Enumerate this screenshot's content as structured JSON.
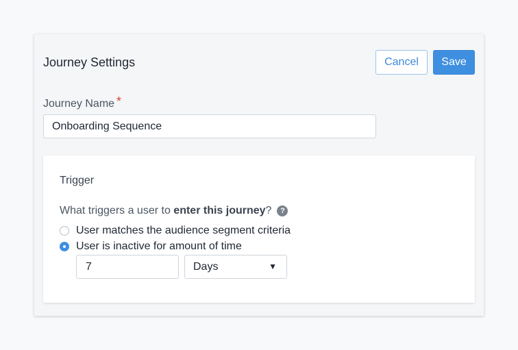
{
  "header": {
    "title": "Journey Settings",
    "cancel_label": "Cancel",
    "save_label": "Save"
  },
  "journey_name": {
    "label": "Journey Name",
    "required_mark": "*",
    "value": "Onboarding Sequence"
  },
  "trigger": {
    "title": "Trigger",
    "question_prefix": "What triggers a user to ",
    "question_bold": "enter this journey",
    "question_suffix": "?",
    "help_glyph": "?",
    "options": [
      {
        "label": "User matches the audience segment criteria",
        "selected": false
      },
      {
        "label": "User is inactive for amount of time",
        "selected": true
      }
    ],
    "amount_value": "7",
    "unit_selected": "Days",
    "caret_glyph": "▼"
  },
  "colors": {
    "accent": "#3f8fe0",
    "required": "#d6453a"
  }
}
